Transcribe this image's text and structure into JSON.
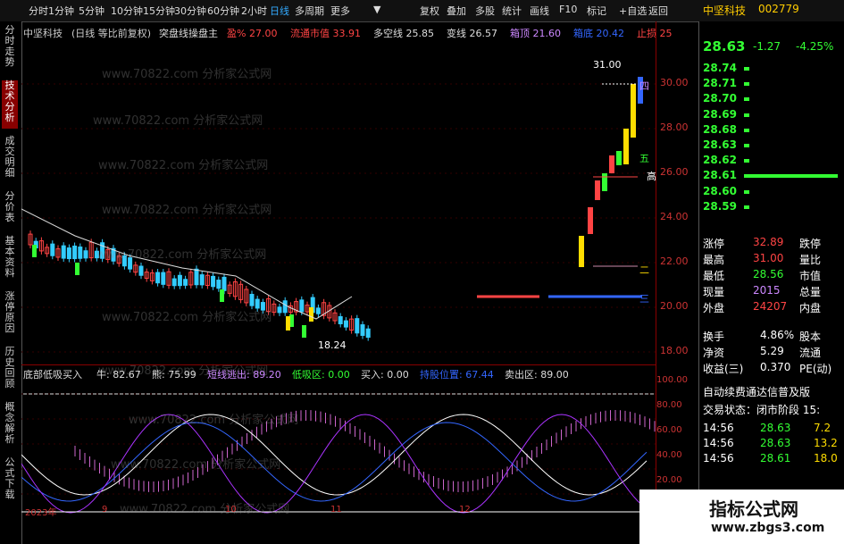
{
  "toolbar": {
    "items": [
      "分时",
      "1分钟",
      "5分钟",
      "10分钟",
      "15分钟",
      "30分钟",
      "60分钟",
      "2小时",
      "日线",
      "多周期",
      "更多"
    ],
    "active": "日线",
    "right": [
      "复权",
      "叠加",
      "多股",
      "统计",
      "画线",
      "F10",
      "标记",
      "+自选",
      "返回"
    ]
  },
  "left_tabs": [
    "分时走势",
    "技术分析",
    "成交明细",
    "分价表",
    "基本资料",
    "涨停原因",
    "历史回顾",
    "概念解析",
    "公式下载"
  ],
  "chart_header": {
    "stock": "中坚科技",
    "mode": "(日线 等比前复权)",
    "indicator": "突盘线操盘主",
    "fields": [
      {
        "label": "盈%",
        "value": "27.00",
        "color": "#f44"
      },
      {
        "label": "流通市值",
        "value": "33.91",
        "color": "#f44"
      },
      {
        "label": "多空线",
        "value": "25.85",
        "color": "#ddd"
      },
      {
        "label": "变线",
        "value": "26.57",
        "color": "#ddd"
      },
      {
        "label": "箱顶",
        "value": "21.60",
        "color": "#c8f"
      },
      {
        "label": "箱底",
        "value": "20.42",
        "color": "#36f"
      },
      {
        "label": "止损",
        "value": "25",
        "color": "#f44"
      }
    ]
  },
  "price_axis": [
    "30.00",
    "28.00",
    "26.00",
    "24.00",
    "22.00",
    "20.00",
    "18.00"
  ],
  "price_labels": {
    "high": "31.00",
    "low": "18.24"
  },
  "markers": [
    "四",
    "五",
    "高",
    "二",
    "三"
  ],
  "sub_header": {
    "name": "底部低吸买入",
    "fields": [
      {
        "label": "牛",
        "value": "82.67",
        "color": "#ddd"
      },
      {
        "label": "熊",
        "value": "75.99",
        "color": "#ddd"
      },
      {
        "label": "短线逃出",
        "value": "89.20",
        "color": "#c8f"
      },
      {
        "label": "低吸区",
        "value": "0.00",
        "color": "#3f3"
      },
      {
        "label": "买入",
        "value": "0.00",
        "color": "#ddd"
      },
      {
        "label": "持股位置",
        "value": "67.44",
        "color": "#36f"
      },
      {
        "label": "卖出区",
        "value": "89.00",
        "color": "#ddd"
      }
    ]
  },
  "sub_axis": [
    "100.00",
    "80.00",
    "60.00",
    "40.00",
    "20.00",
    "0.00"
  ],
  "date_axis": [
    "2023年",
    "9",
    "10",
    "11",
    "12"
  ],
  "watermark": "www.70822.com 分析家公式网",
  "quote": {
    "name": "中坚科技",
    "code": "002779",
    "price": "28.63",
    "change": "-1.27",
    "pct": "-4.25%",
    "bids": [
      {
        "p": "28.74",
        "bar": 0.05
      },
      {
        "p": "28.71",
        "bar": 0.05
      },
      {
        "p": "28.70",
        "bar": 0.05
      },
      {
        "p": "28.69",
        "bar": 0.05
      },
      {
        "p": "28.68",
        "bar": 0.05
      },
      {
        "p": "28.63",
        "bar": 0.05
      },
      {
        "p": "28.62",
        "bar": 0.05
      },
      {
        "p": "28.61",
        "bar": 0.95
      },
      {
        "p": "28.60",
        "bar": 0.05
      },
      {
        "p": "28.59",
        "bar": 0.05
      }
    ],
    "stats": [
      {
        "l": "涨停",
        "v": "32.89",
        "c": "#f44",
        "l2": "跌停"
      },
      {
        "l": "最高",
        "v": "31.00",
        "c": "#f44",
        "l2": "量比"
      },
      {
        "l": "最低",
        "v": "28.56",
        "c": "#3f3",
        "l2": "市值"
      },
      {
        "l": "现量",
        "v": "2015",
        "c": "#c8f",
        "l2": "总量"
      },
      {
        "l": "外盘",
        "v": "24207",
        "c": "#f44",
        "l2": "内盘"
      }
    ],
    "stats2": [
      {
        "l": "换手",
        "v": "4.86%",
        "c": "#fff",
        "l2": "股本"
      },
      {
        "l": "净资",
        "v": "5.29",
        "c": "#fff",
        "l2": "流通"
      },
      {
        "l": "收益(三)",
        "v": "0.370",
        "c": "#fff",
        "l2": "PE(动)"
      }
    ],
    "notice": "自动续费通达信普及版",
    "trade_state": "交易状态：闭市阶段 15:",
    "ticks": [
      {
        "t": "14:56",
        "p": "28.63",
        "v": "7.2"
      },
      {
        "t": "14:56",
        "p": "28.63",
        "v": "13.2"
      },
      {
        "t": "14:56",
        "p": "28.61",
        "v": "18.0"
      }
    ]
  },
  "badge": {
    "title": "指标公式网",
    "url": "www.zbgs3.com"
  }
}
